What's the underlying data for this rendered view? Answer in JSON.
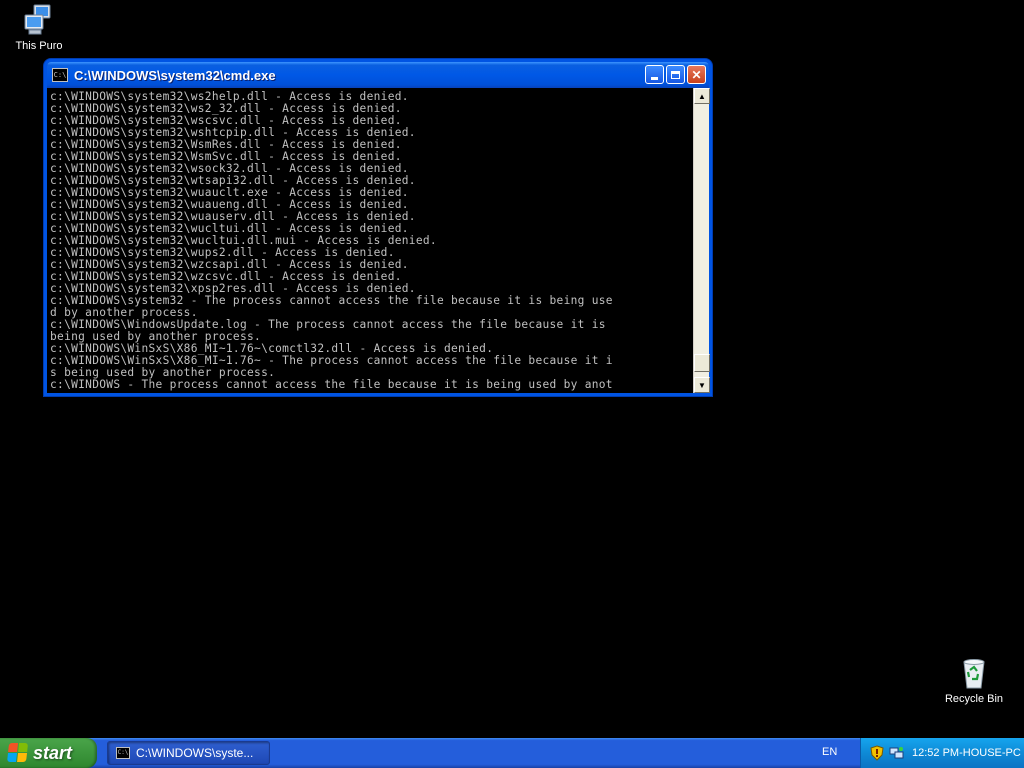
{
  "desktop": {
    "icons": [
      {
        "label": "This Puro"
      },
      {
        "label": "Recycle Bin"
      }
    ]
  },
  "window": {
    "title": "C:\\WINDOWS\\system32\\cmd.exe",
    "icon_text": "C:\\",
    "console_lines": [
      "c:\\WINDOWS\\system32\\ws2help.dll - Access is denied.",
      "c:\\WINDOWS\\system32\\ws2_32.dll - Access is denied.",
      "c:\\WINDOWS\\system32\\wscsvc.dll - Access is denied.",
      "c:\\WINDOWS\\system32\\wshtcpip.dll - Access is denied.",
      "c:\\WINDOWS\\system32\\WsmRes.dll - Access is denied.",
      "c:\\WINDOWS\\system32\\WsmSvc.dll - Access is denied.",
      "c:\\WINDOWS\\system32\\wsock32.dll - Access is denied.",
      "c:\\WINDOWS\\system32\\wtsapi32.dll - Access is denied.",
      "c:\\WINDOWS\\system32\\wuauclt.exe - Access is denied.",
      "c:\\WINDOWS\\system32\\wuaueng.dll - Access is denied.",
      "c:\\WINDOWS\\system32\\wuauserv.dll - Access is denied.",
      "c:\\WINDOWS\\system32\\wucltui.dll - Access is denied.",
      "c:\\WINDOWS\\system32\\wucltui.dll.mui - Access is denied.",
      "c:\\WINDOWS\\system32\\wups2.dll - Access is denied.",
      "c:\\WINDOWS\\system32\\wzcsapi.dll - Access is denied.",
      "c:\\WINDOWS\\system32\\wzcsvc.dll - Access is denied.",
      "c:\\WINDOWS\\system32\\xpsp2res.dll - Access is denied.",
      "c:\\WINDOWS\\system32 - The process cannot access the file because it is being use",
      "d by another process.",
      "c:\\WINDOWS\\WindowsUpdate.log - The process cannot access the file because it is",
      "being used by another process.",
      "c:\\WINDOWS\\WinSxS\\X86_MI~1.76~\\comctl32.dll - Access is denied.",
      "c:\\WINDOWS\\WinSxS\\X86_MI~1.76~ - The process cannot access the file because it i",
      "s being used by another process.",
      "c:\\WINDOWS - The process cannot access the file because it is being used by anot"
    ],
    "scroll_position": 0.98
  },
  "taskbar": {
    "start_label": "start",
    "task_button_label": "C:\\WINDOWS\\syste...",
    "language": "EN",
    "clock": "12:52 PM-HOUSE-PC"
  }
}
